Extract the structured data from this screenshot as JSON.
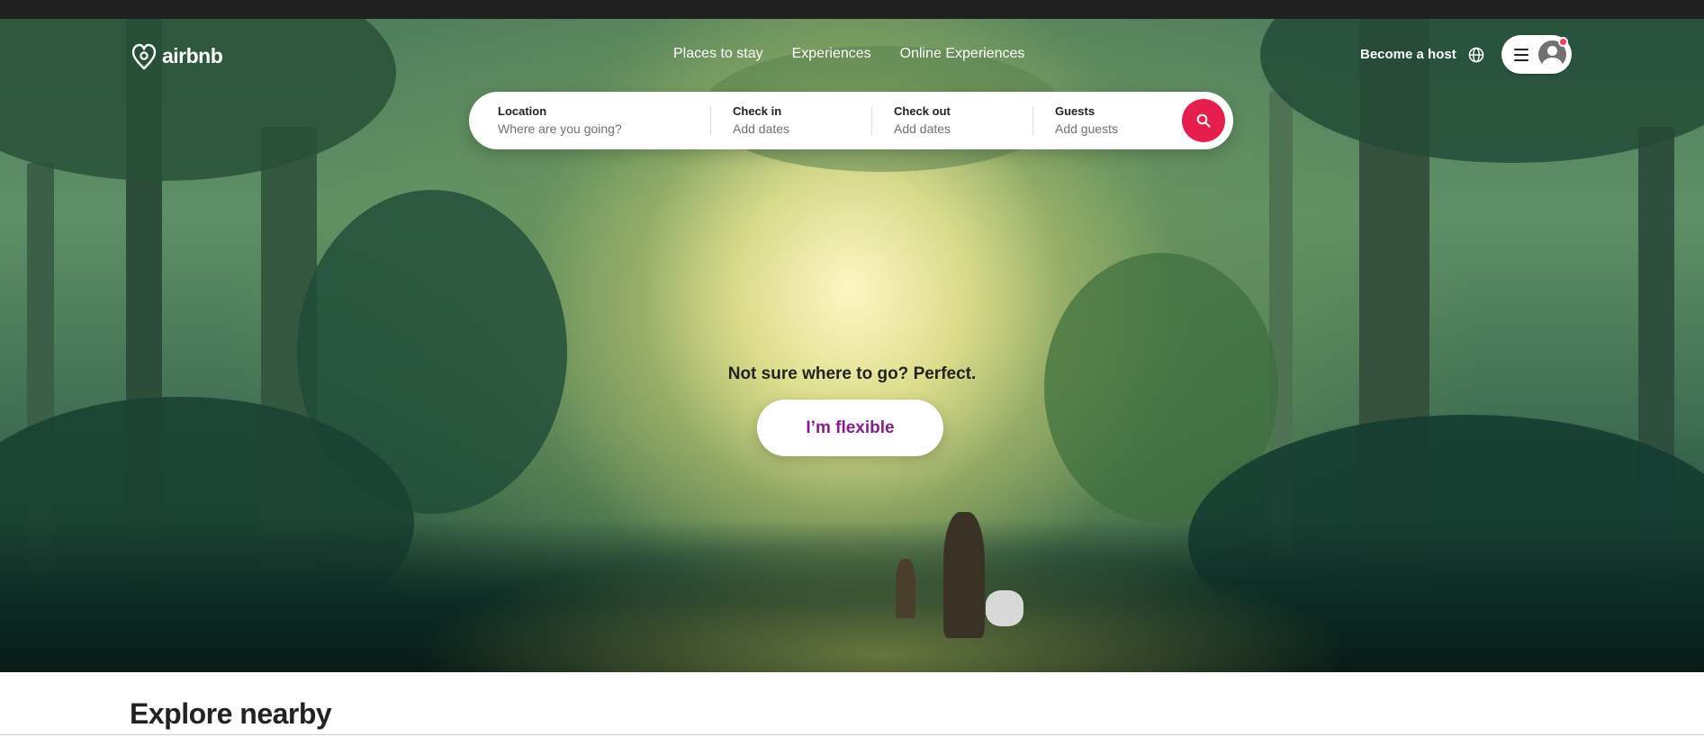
{
  "brand": {
    "name": "airbnb",
    "accent": "#FF385C",
    "flexible_color": "#8A1A8F"
  },
  "nav": {
    "items": [
      {
        "label": "Places to stay"
      },
      {
        "label": "Experiences"
      },
      {
        "label": "Online Experiences"
      }
    ]
  },
  "header": {
    "host_label": "Become a host",
    "icons": {
      "language": "globe-icon",
      "menu": "hamburger-icon",
      "profile": "avatar-icon"
    }
  },
  "search": {
    "location": {
      "label": "Location",
      "placeholder": "Where are you going?"
    },
    "check_in": {
      "label": "Check in",
      "placeholder": "Add dates"
    },
    "check_out": {
      "label": "Check out",
      "placeholder": "Add dates"
    },
    "guests": {
      "label": "Guests",
      "placeholder": "Add guests"
    },
    "button_icon": "search-icon"
  },
  "hero": {
    "tagline": "Not sure where to go? Perfect.",
    "cta_label": "I’m flexible"
  },
  "explore": {
    "title": "Explore nearby"
  }
}
